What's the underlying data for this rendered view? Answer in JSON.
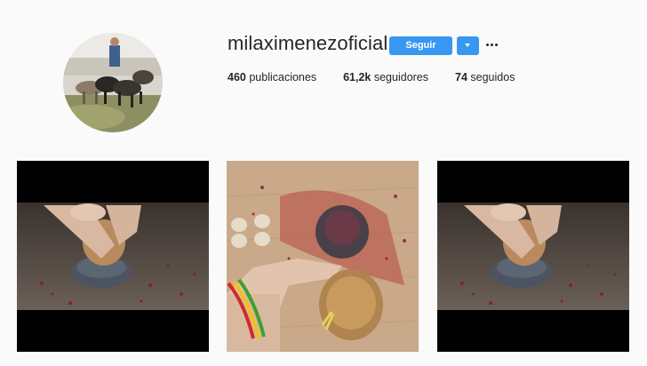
{
  "profile": {
    "username": "milaximenezoficial",
    "follow_label": "Seguir",
    "avatar_icon": "profile-photo-man-with-dogs",
    "dropdown_icon": "caret-down-icon",
    "more_icon": "ellipsis-icon"
  },
  "stats": [
    {
      "count": "460",
      "label": "publicaciones"
    },
    {
      "count": "61,2k",
      "label": "seguidores"
    },
    {
      "count": "74",
      "label": "seguidos"
    }
  ],
  "posts": [
    {
      "image": "hands-holding-chicken-over-bowl-photo"
    },
    {
      "image": "hand-pointing-at-chicken-and-bowls-photo"
    },
    {
      "image": "hands-holding-chicken-over-bowl-photo"
    }
  ],
  "colors": {
    "accent": "#3897f0",
    "background": "#fafafa",
    "text": "#262626"
  }
}
